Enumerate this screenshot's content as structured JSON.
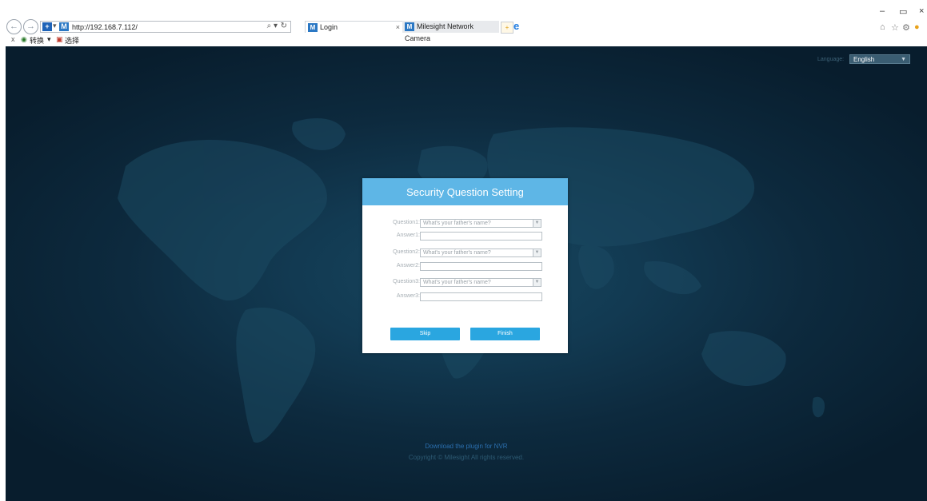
{
  "browser": {
    "url": "http://192.168.7.112/",
    "search_glyph": "⌕ ▾",
    "refresh_glyph": "↻",
    "tabs": [
      {
        "label": "Login",
        "close": "×"
      },
      {
        "label": "Milesight Network Camera"
      }
    ],
    "favorites": {
      "close": "x",
      "item1": "转换",
      "item1_drop": "▾",
      "item2": "选择"
    },
    "window_controls": {
      "minimize": "–",
      "restore": "▭",
      "close": "×"
    }
  },
  "page": {
    "language_label": "Language:",
    "language_value": "English",
    "dialog": {
      "title": "Security Question Setting",
      "rows": [
        {
          "label": "Question1:",
          "value": "What's your father's name?",
          "type": "select"
        },
        {
          "label": "Answer1:",
          "value": "",
          "type": "input"
        },
        {
          "label": "Question2:",
          "value": "What's your father's name?",
          "type": "select"
        },
        {
          "label": "Answer2:",
          "value": "",
          "type": "input"
        },
        {
          "label": "Question3:",
          "value": "What's your father's name?",
          "type": "select"
        },
        {
          "label": "Answer3:",
          "value": "",
          "type": "input"
        }
      ],
      "skip_label": "Skip",
      "finish_label": "Finish"
    },
    "footer": {
      "download_link": "Download the plugin for NVR",
      "copyright": "Copyright © Milesight All rights reserved."
    }
  },
  "colors": {
    "dialog_header": "#5eb6e6",
    "button": "#2aa6e0",
    "background": "#0d2a3e"
  }
}
